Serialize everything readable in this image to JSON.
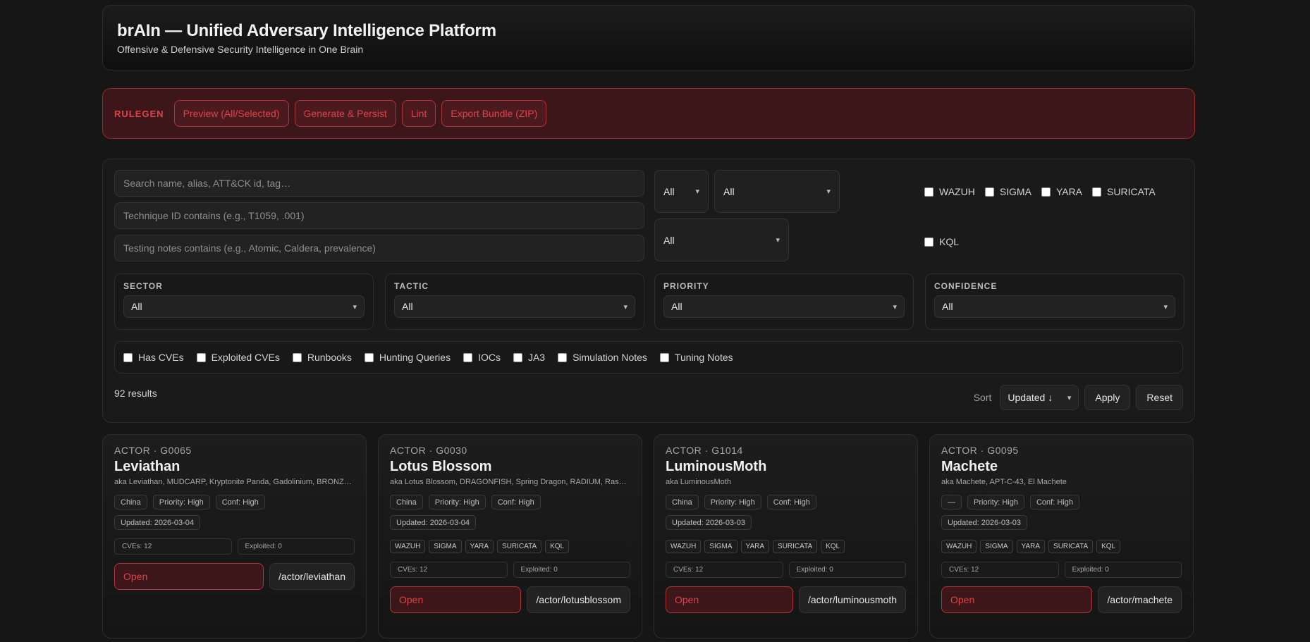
{
  "header": {
    "title": "brAIn — Unified Adversary Intelligence Platform",
    "subtitle": "Offensive & Defensive Security Intelligence in One Brain"
  },
  "rulegen": {
    "label": "RULEGEN",
    "buttons": [
      "Preview (All/Selected)",
      "Generate & Persist",
      "Lint",
      "Export Bundle (ZIP)"
    ]
  },
  "filters": {
    "search_placeholder": "Search name, alias, ATT&CK id, tag…",
    "technique_placeholder": "Technique ID contains (e.g., T1059, .001)",
    "testing_placeholder": "Testing notes contains (e.g., Atomic, Caldera, prevalence)",
    "select_a": "All",
    "select_b": "All",
    "select_c": "All",
    "rule_types": [
      "WAZUH",
      "SIGMA",
      "YARA",
      "SURICATA"
    ],
    "rule_type_kql": "KQL",
    "facets": [
      {
        "label": "SECTOR",
        "value": "All"
      },
      {
        "label": "TACTIC",
        "value": "All"
      },
      {
        "label": "PRIORITY",
        "value": "All"
      },
      {
        "label": "CONFIDENCE",
        "value": "All"
      }
    ],
    "flags": [
      "Has CVEs",
      "Exploited CVEs",
      "Runbooks",
      "Hunting Queries",
      "IOCs",
      "JA3",
      "Simulation Notes",
      "Tuning Notes"
    ],
    "results": "92 results",
    "sort_label": "Sort",
    "sort_value": "Updated ↓",
    "apply": "Apply",
    "reset": "Reset"
  },
  "cards": [
    {
      "kind": "ACTOR · G0065",
      "name": "Leviathan",
      "aka": "aka Leviathan, MUDCARP, Kryptonite Panda, Gadolinium, BRONZE MOHAWK",
      "country": "China",
      "priority": "Priority: High",
      "confidence": "Conf: High",
      "updated": "Updated: 2026-03-04",
      "tags": [],
      "cves": "CVEs: 12",
      "exploited": "Exploited: 0",
      "open": "Open",
      "path": "/actor/leviathan"
    },
    {
      "kind": "ACTOR · G0030",
      "name": "Lotus Blossom",
      "aka": "aka Lotus Blossom, DRAGONFISH, Spring Dragon, RADIUM, Raspberry Typhoon",
      "country": "China",
      "priority": "Priority: High",
      "confidence": "Conf: High",
      "updated": "Updated: 2026-03-04",
      "tags": [
        "WAZUH",
        "SIGMA",
        "YARA",
        "SURICATA",
        "KQL"
      ],
      "cves": "CVEs: 12",
      "exploited": "Exploited: 0",
      "open": "Open",
      "path": "/actor/lotusblossom"
    },
    {
      "kind": "ACTOR · G1014",
      "name": "LuminousMoth",
      "aka": "aka LuminousMoth",
      "country": "China",
      "priority": "Priority: High",
      "confidence": "Conf: High",
      "updated": "Updated: 2026-03-03",
      "tags": [
        "WAZUH",
        "SIGMA",
        "YARA",
        "SURICATA",
        "KQL"
      ],
      "cves": "CVEs: 12",
      "exploited": "Exploited: 0",
      "open": "Open",
      "path": "/actor/luminousmoth"
    },
    {
      "kind": "ACTOR · G0095",
      "name": "Machete",
      "aka": "aka Machete, APT-C-43, El Machete",
      "country": "—",
      "priority": "Priority: High",
      "confidence": "Conf: High",
      "updated": "Updated: 2026-03-03",
      "tags": [
        "WAZUH",
        "SIGMA",
        "YARA",
        "SURICATA",
        "KQL"
      ],
      "cves": "CVEs: 12",
      "exploited": "Exploited: 0",
      "open": "Open",
      "path": "/actor/machete"
    }
  ]
}
